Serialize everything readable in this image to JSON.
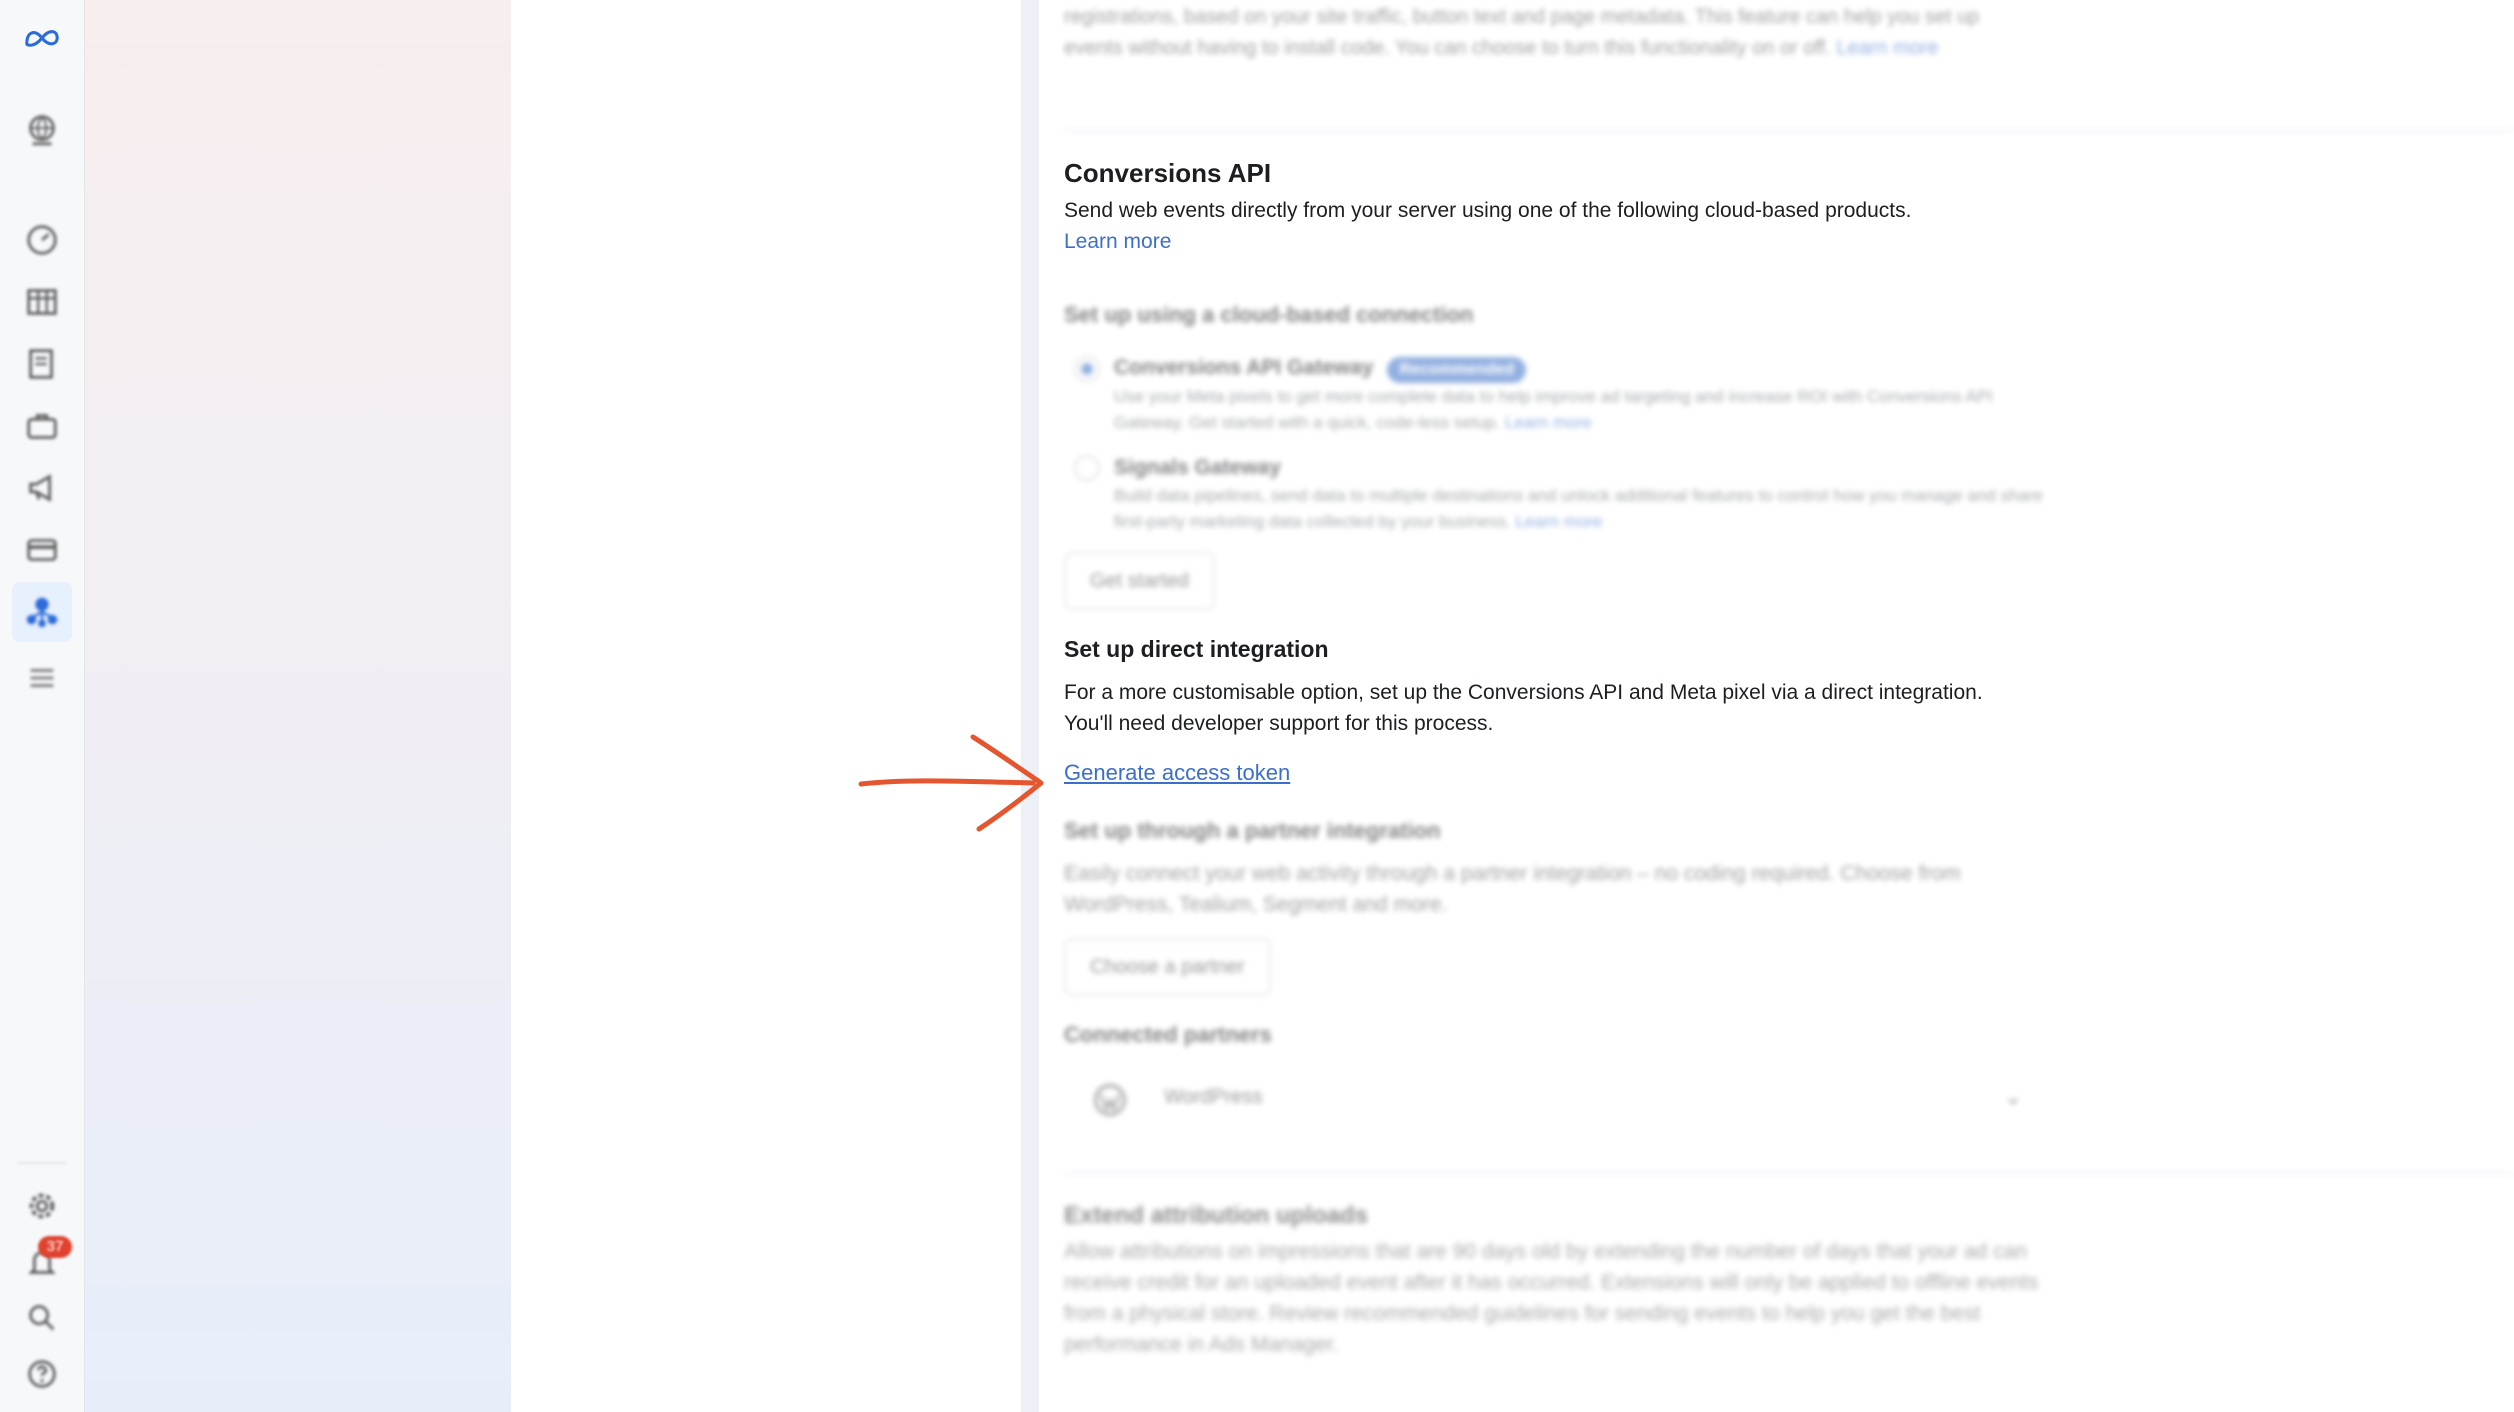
{
  "colors": {
    "accent": "#3b6fc9",
    "annotation_arrow": "#e4562f",
    "badge": "#e0422f"
  },
  "nav_rail": {
    "icons": [
      "meta-logo-icon",
      "globe-icon",
      "dashboard-icon",
      "table-icon",
      "pages-icon",
      "briefcase-icon",
      "megaphone-icon",
      "credit-card-icon",
      "people-tree-icon",
      "menu-icon",
      "settings-icon",
      "bell-icon",
      "search-icon",
      "help-icon"
    ],
    "notification_count": "37"
  },
  "sections": {
    "automatic_events": {
      "text": "registrations, based on your site traffic, button text and page metadata. This feature can help you set up events without having to install code. You can choose to turn this functionality on or off.",
      "link": "Learn more"
    },
    "conversions_api": {
      "title": "Conversions API",
      "description": "Send web events directly from your server using one of the following cloud-based products.",
      "learn_more": "Learn more",
      "cloud_heading": "Set up using a cloud-based connection",
      "options": [
        {
          "title": "Conversions API Gateway",
          "badge": "Recommended",
          "description": "Use your Meta pixels to get more complete data to help improve ad targeting and increase ROI with Conversions API Gateway. Get started with a quick, code-less setup.",
          "link": "Learn more",
          "selected": true
        },
        {
          "title": "Signals Gateway",
          "description": "Build data pipelines, send data to multiple destinations and unlock additional features to control how you manage and share first-party marketing data collected by your business.",
          "link": "Learn more",
          "selected": false
        }
      ],
      "get_started": "Get started"
    },
    "direct_integration": {
      "title": "Set up direct integration",
      "description": "For a more customisable option, set up the Conversions API and Meta pixel via a direct integration. You'll need developer support for this process.",
      "link": "Generate access token"
    },
    "partner_integration": {
      "title": "Set up through a partner integration",
      "description": "Easily connect your web activity through a partner integration – no coding required. Choose from WordPress, Tealium, Segment and more.",
      "button": "Choose a partner",
      "connected_heading": "Connected partners",
      "connected": "WordPress"
    },
    "extend_attribution": {
      "title": "Extend attribution uploads",
      "description": "Allow attributions on impressions that are 90 days old by extending the number of days that your ad can receive credit for an uploaded event after it has occurred. Extensions will only be applied to offline events from a physical store. Review recommended guidelines for sending events to help you get the best performance in Ads Manager."
    }
  }
}
